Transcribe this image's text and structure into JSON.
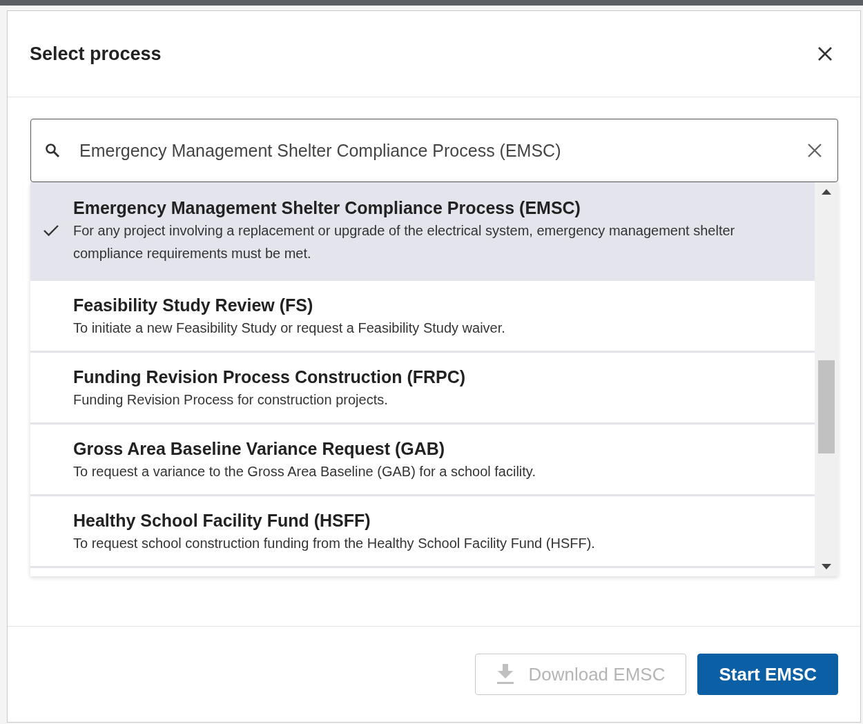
{
  "dialog": {
    "title": "Select process"
  },
  "search": {
    "value": "Emergency Management Shelter Compliance Process (EMSC)"
  },
  "options": [
    {
      "title": "Emergency Management Shelter Compliance Process (EMSC)",
      "description": "For any project involving a replacement or upgrade of the electrical system, emergency management shelter compliance requirements must be met.",
      "selected": true
    },
    {
      "title": "Feasibility Study Review (FS)",
      "description": "To initiate a new Feasibility Study or request a Feasibility Study waiver.",
      "selected": false
    },
    {
      "title": "Funding Revision Process Construction (FRPC)",
      "description": "Funding Revision Process for construction projects.",
      "selected": false
    },
    {
      "title": "Gross Area Baseline Variance Request (GAB)",
      "description": "To request a variance to the Gross Area Baseline (GAB) for a school facility.",
      "selected": false
    },
    {
      "title": "Healthy School Facility Fund (HSFF)",
      "description": "To request school construction funding from the Healthy School Facility Fund (HSFF).",
      "selected": false
    }
  ],
  "buttons": [
    {
      "label": "Download EMSC",
      "kind": "download",
      "disabled": true
    },
    {
      "label": "Start EMSC",
      "kind": "primary",
      "disabled": false
    }
  ]
}
